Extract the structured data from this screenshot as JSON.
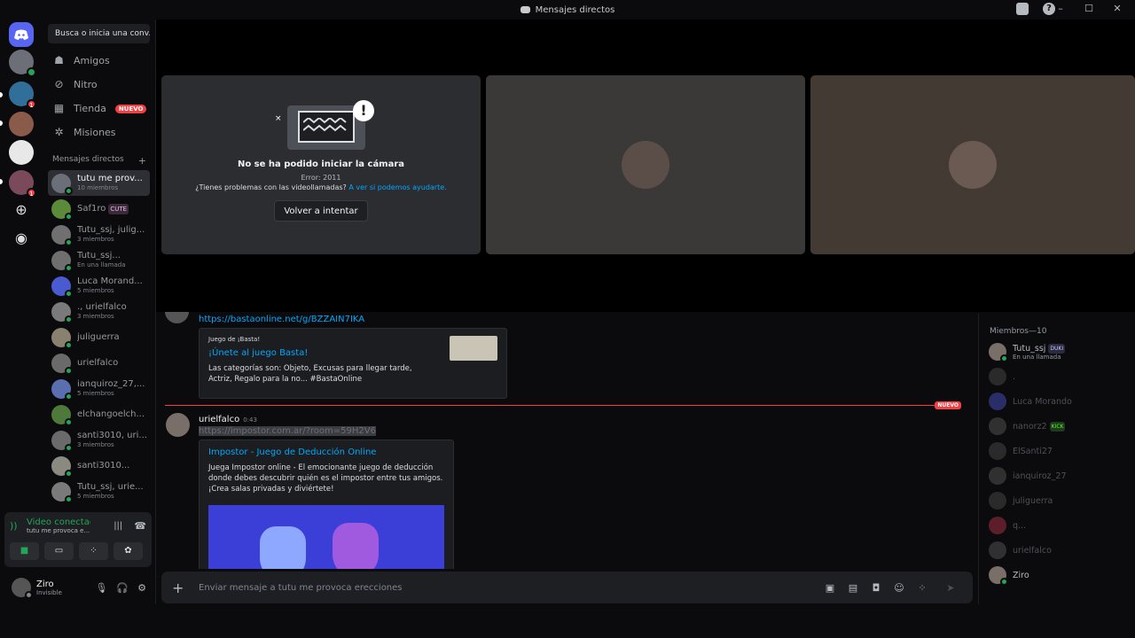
{
  "window": {
    "title": "Mensajes directos"
  },
  "search": {
    "placeholder": "Busca o inicia una conv..."
  },
  "nav": [
    {
      "label": "Amigos",
      "icon": "friends-icon"
    },
    {
      "label": "Nitro",
      "icon": "nitro-icon"
    },
    {
      "label": "Tienda",
      "icon": "shop-icon",
      "badge": "NUEVO"
    },
    {
      "label": "Misiones",
      "icon": "quests-icon"
    }
  ],
  "dm_header": {
    "label": "Mensajes directos",
    "add": "+"
  },
  "dms": [
    {
      "name": "tutu me prov...",
      "sub": "10 miembros",
      "active": true
    },
    {
      "name": "Saf1ro",
      "tag": "CUTE",
      "sub": ""
    },
    {
      "name": "Tutu_ssj, julig...",
      "sub": "3 miembros"
    },
    {
      "name": "Tutu_ssj...",
      "sub": "En una llamada"
    },
    {
      "name": "Luca Morand...",
      "sub": "5 miembros"
    },
    {
      "name": "., urielfalco",
      "sub": "3 miembros"
    },
    {
      "name": "juliguerra",
      "sub": ""
    },
    {
      "name": "urielfalco",
      "sub": ""
    },
    {
      "name": "ianquiroz_27,...",
      "sub": "5 miembros"
    },
    {
      "name": "elchangoelch...",
      "sub": ""
    },
    {
      "name": "santi3010, uri...",
      "sub": "3 miembros"
    },
    {
      "name": "santi3010...",
      "sub": ""
    },
    {
      "name": "Tutu_ssj, urie...",
      "sub": "5 miembros"
    }
  ],
  "voice": {
    "status": "Video conectado",
    "channel": "tutu me provoca e..."
  },
  "user": {
    "name": "Ziro",
    "status": "Invisible"
  },
  "camera_error": {
    "title": "No se ha podido iniciar la cámara",
    "error": "Error: 2011",
    "help_text": "¿Tienes problemas con las videollamadas?",
    "help_link": "A ver si podemos ayudarte.",
    "retry": "Volver a intentar"
  },
  "messages": {
    "first_link": "https://bastaonline.net/g/BZZAIN7IKA",
    "basta_embed": {
      "provider": "Juego de ¡Basta!",
      "title": "¡Únete al juego Basta!",
      "desc": "Las categorías son: Objeto, Excusas para llegar tarde, Actriz, Regalo para la no... #BastaOnline"
    },
    "new_badge": "NUEVO",
    "author": "urielfalco",
    "time": "0:43",
    "link": "https://impostor.com.ar/?room=59H2V6",
    "impostor_embed": {
      "title": "Impostor - Juego de Deducción Online",
      "desc": "Juega Impostor online - El emocionante juego de deducción donde debes descubrir quién es el impostor entre tus amigos. ¡Crea salas privadas y diviértete!"
    }
  },
  "composer": {
    "placeholder": "Enviar mensaje a tutu me provoca erecciones"
  },
  "members": {
    "header": "Miembros—10",
    "list": [
      {
        "name": "Tutu_ssj",
        "tag": "DUKI",
        "sub": "En una llamada",
        "dim": false
      },
      {
        "name": ".",
        "dim": true
      },
      {
        "name": "Luca Morando",
        "dim": true
      },
      {
        "name": "nanorz2",
        "tag": "KICK",
        "dim": true
      },
      {
        "name": "ElSanti27",
        "dim": true
      },
      {
        "name": "ianquiroz_27",
        "dim": true
      },
      {
        "name": "juliguerra",
        "dim": true
      },
      {
        "name": "q...",
        "dim": true
      },
      {
        "name": "urielfalco",
        "dim": true
      },
      {
        "name": "Ziro",
        "dim": false
      }
    ]
  },
  "colors": {
    "accent": "#5865f2",
    "online": "#23a55a",
    "danger": "#f23f43",
    "link": "#00a8fc"
  }
}
